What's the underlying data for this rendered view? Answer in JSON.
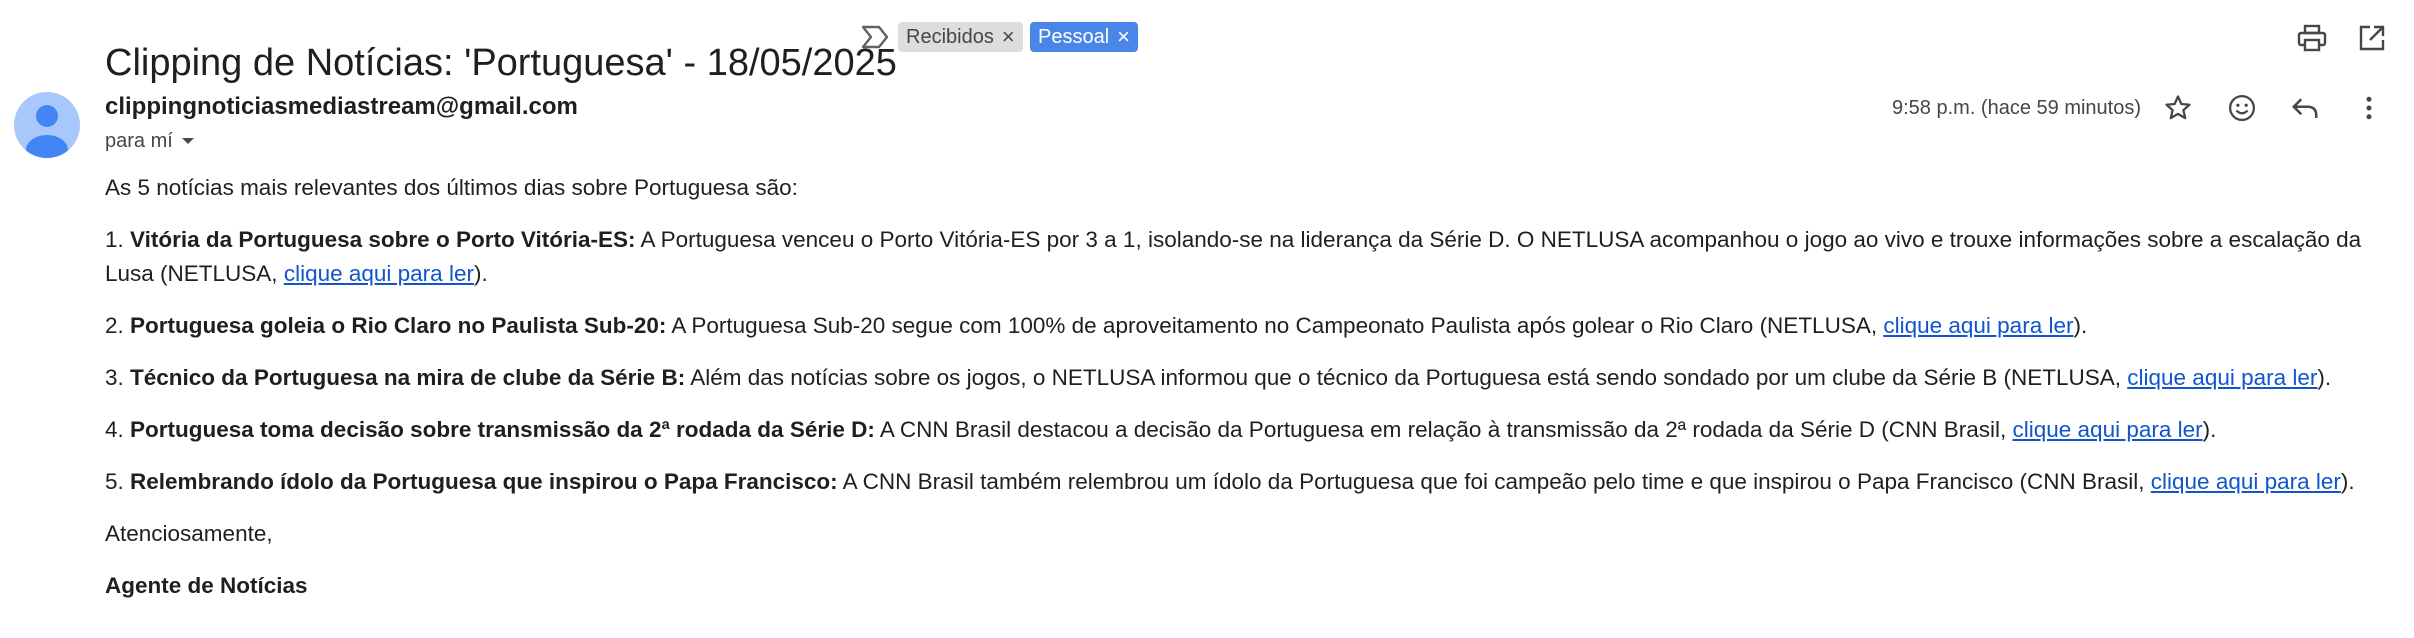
{
  "header": {
    "subject": "Clipping de Notícias: 'Portuguesa' - 18/05/2025",
    "labels": [
      {
        "text": "Recibidos",
        "remove": "×"
      },
      {
        "text": "Pessoal",
        "remove": "×"
      }
    ],
    "icons": {
      "important": "importance-marker-icon",
      "print": "print-icon",
      "open_new_window": "open-in-new-window-icon"
    }
  },
  "message": {
    "sender": "clippingnoticiasmediastream@gmail.com",
    "to": "para mí",
    "timestamp": "9:58 p.m. (hace 59 minutos)",
    "action_icons": [
      "star-icon",
      "emoji-reaction-icon",
      "reply-icon",
      "more-options-icon"
    ]
  },
  "body": {
    "intro": "As 5 notícias mais relevantes dos últimos dias sobre Portuguesa são:",
    "items": [
      {
        "num": "1. ",
        "title": "Vitória da Portuguesa sobre o Porto Vitória-ES:",
        "text": " A Portuguesa venceu o Porto Vitória-ES por 3 a 1, isolando-se na liderança da Série D. O NETLUSA acompanhou o jogo ao vivo e trouxe informações sobre a escalação da Lusa (NETLUSA, ",
        "link": "clique aqui para ler",
        "end": ")."
      },
      {
        "num": "2. ",
        "title": "Portuguesa goleia o Rio Claro no Paulista Sub-20:",
        "text": " A Portuguesa Sub-20 segue com 100% de aproveitamento no Campeonato Paulista após golear o Rio Claro (NETLUSA, ",
        "link": "clique aqui para ler",
        "end": ")."
      },
      {
        "num": "3. ",
        "title": "Técnico da Portuguesa na mira de clube da Série B:",
        "text": " Além das notícias sobre os jogos, o NETLUSA informou que o técnico da Portuguesa está sendo sondado por um clube da Série B (NETLUSA, ",
        "link": "clique aqui para ler",
        "end": ")."
      },
      {
        "num": "4. ",
        "title": "Portuguesa toma decisão sobre transmissão da 2ª rodada da Série D:",
        "text": " A CNN Brasil destacou a decisão da Portuguesa em relação à transmissão da 2ª rodada da Série D (CNN Brasil, ",
        "link": "clique aqui para ler",
        "end": ")."
      },
      {
        "num": "5. ",
        "title": "Relembrando ídolo da Portuguesa que inspirou o Papa Francisco:",
        "text": " A CNN Brasil também relembrou um ídolo da Portuguesa que foi campeão pelo time e que inspirou o Papa Francisco (CNN Brasil, ",
        "link": "clique aqui para ler",
        "end": ")."
      }
    ],
    "closing": "Atenciosamente,",
    "signature": "Agente de Notícias"
  },
  "colors": {
    "link": "#1155cc",
    "pessoal_label": "#4a86e8",
    "recibidos_label": "#dddddd",
    "avatar": "#a8c7fa",
    "avatar_figure": "#4285f4"
  }
}
